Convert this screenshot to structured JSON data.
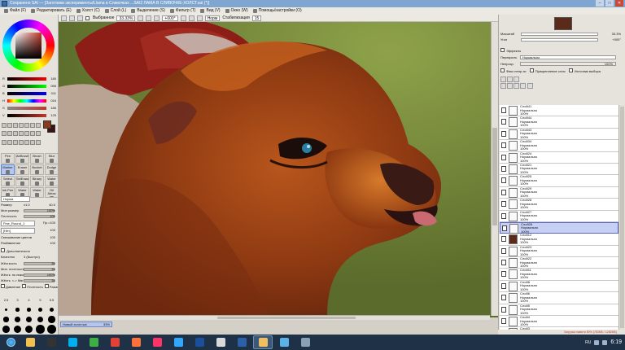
{
  "window": {
    "title": "Сохранено SAI — [Заготовки эксперименты/Llama в Сливочках ...SAI2 ЛАМА В СЛИВОЧКЕ-ХОЛСТ.sai (*)]",
    "min": "–",
    "max": "□",
    "close": "✕"
  },
  "menu": [
    "Файл (F)",
    "Редактировать (E)",
    "Холст (C)",
    "Слой (L)",
    "Выделение (S)",
    "Фильтр (T)",
    "Вид (V)",
    "Окно (W)",
    "Помощь/настройки (O)"
  ],
  "toolbar": {
    "select_label": "Выбранное",
    "zoom": "33.33%",
    "rotation": "+000°",
    "mode_label": "Норм",
    "stabilizer_label": "Стабилизация",
    "stabilizer_value": "15"
  },
  "color": {
    "sliders": [
      {
        "label": "R",
        "value": "180"
      },
      {
        "label": "G",
        "value": "055"
      },
      {
        "label": "B",
        "value": "011"
      },
      {
        "label": "H",
        "value": "016"
      },
      {
        "label": "S",
        "value": "186"
      },
      {
        "label": "V",
        "value": "125"
      }
    ],
    "fg": "#8a3a1d",
    "bg": "#3a1210"
  },
  "tools": [
    {
      "label": "Pen",
      "sel": false
    },
    {
      "label": "AirBrush",
      "sel": false
    },
    {
      "label": "Brush",
      "sel": false
    },
    {
      "label": "Blur",
      "sel": false
    },
    {
      "label": "Marker",
      "sel": true
    },
    {
      "label": "Eraser",
      "sel": false
    },
    {
      "label": "Bucket",
      "sel": false
    },
    {
      "label": "Dodge",
      "sel": false
    },
    {
      "label": "Select",
      "sel": false
    },
    {
      "label": "SelEraser",
      "sel": false
    },
    {
      "label": "Binary",
      "sel": false
    },
    {
      "label": "Water",
      "sel": false
    },
    {
      "label": "Ink Pen",
      "sel": false
    },
    {
      "label": "Water",
      "sel": false
    },
    {
      "label": "Water",
      "sel": false
    },
    {
      "label": "Oil Alexa",
      "sel": false
    }
  ],
  "brush": {
    "mode": "Норма",
    "size_label": "Размер",
    "size_mult": "x1.0",
    "size_value": "40.0",
    "min_size_label": "Мин размер",
    "min_size_value": "100%",
    "density_label": "Плотность",
    "density_value": "100",
    "shape": "Fine_Round_1",
    "shape_strength": "Пр.=100",
    "texture": "[Нет]",
    "texture_strength": "100",
    "blending_label": "Смешивание цветов",
    "blending_value": "100",
    "dilution_label": "Разбавление",
    "dilution_value": "100",
    "advanced_label": "Дополнительно",
    "quality_label": "Качество",
    "quality_value": "3 (Быстро)",
    "hardness_label": "Жёсткость",
    "hardness_value": "84",
    "minDensity_label": "Мин. плотность",
    "minDensity_value": "54",
    "maxDensity_label": "Жёстк. по пиксе",
    "maxDensity_value": "100%",
    "pressure_label": "Жёстк. <-> Мягк",
    "pressure_value": "54",
    "pressure_flags": [
      "Давление",
      "Плотность",
      "Размер"
    ],
    "presets": [
      "2.5",
      "3",
      "4",
      "5",
      "5.5",
      "6",
      "7",
      "8",
      "9",
      "10",
      "12",
      "14",
      "16",
      "20",
      "25",
      "30",
      "35",
      "40",
      "50",
      "60"
    ]
  },
  "canvas_tab": {
    "name": "Новый холст.sai",
    "percent": "33%"
  },
  "navigator": {
    "zoom_label": "Масштаб",
    "zoom_value": "33.3%",
    "angle_label": "Угол",
    "angle_value": "+000°"
  },
  "layer_panel": {
    "effects_label": "Эффекты",
    "blend_label": "Перекрыть",
    "blend_value": "Нормально",
    "opacity_label": "Непрозр.",
    "opacity_value": "100%",
    "protect_label": "Фикс непр-ти",
    "clip_label": "Прикрепление слоя",
    "source_label": "Источник выбора"
  },
  "layers": [
    {
      "name": "Слой41",
      "mode": "Нормально",
      "opacity": "100%",
      "thumb": "light",
      "selected": false
    },
    {
      "name": "Слой44",
      "mode": "Нормально",
      "opacity": "100%",
      "thumb": "light",
      "selected": false
    },
    {
      "name": "Слой43",
      "mode": "Нормально",
      "opacity": "100%",
      "thumb": "light",
      "selected": false
    },
    {
      "name": "Слой34",
      "mode": "Нормально",
      "opacity": "100%",
      "thumb": "light",
      "selected": false
    },
    {
      "name": "Слой24",
      "mode": "Нормально",
      "opacity": "100%",
      "thumb": "light",
      "selected": false
    },
    {
      "name": "Слой21",
      "mode": "Нормально",
      "opacity": "100%",
      "thumb": "light",
      "selected": false
    },
    {
      "name": "Слой25",
      "mode": "Нормально",
      "opacity": "100%",
      "thumb": "light",
      "selected": false
    },
    {
      "name": "Слой29",
      "mode": "Нормально",
      "opacity": "100%",
      "thumb": "light",
      "selected": false
    },
    {
      "name": "Слой28",
      "mode": "Нормально",
      "opacity": "100%",
      "thumb": "light",
      "selected": false
    },
    {
      "name": "Слой27",
      "mode": "Нормально",
      "opacity": "100%",
      "thumb": "light",
      "selected": false
    },
    {
      "name": "Слой26",
      "mode": "Нормально",
      "opacity": "100%",
      "thumb": "light",
      "selected": true
    },
    {
      "name": "Слой12",
      "mode": "Нормально",
      "opacity": "100%",
      "thumb": "dark",
      "selected": false
    },
    {
      "name": "Слой23",
      "mode": "Нормально",
      "opacity": "100%",
      "thumb": "light",
      "selected": false
    },
    {
      "name": "Слой22",
      "mode": "Нормально",
      "opacity": "100%",
      "thumb": "light",
      "selected": false
    },
    {
      "name": "Слой11",
      "mode": "Нормально",
      "opacity": "100%",
      "thumb": "light",
      "selected": false
    },
    {
      "name": "Слой8",
      "mode": "Нормально",
      "opacity": "100%",
      "thumb": "light",
      "selected": false
    },
    {
      "name": "Слой6",
      "mode": "Нормально",
      "opacity": "100%",
      "thumb": "light",
      "selected": false
    },
    {
      "name": "Слой5",
      "mode": "Нормально",
      "opacity": "100%",
      "thumb": "light",
      "selected": false
    },
    {
      "name": "Слой4",
      "mode": "Нормально",
      "opacity": "100%",
      "thumb": "light",
      "selected": false
    },
    {
      "name": "Слой3",
      "mode": "Нормально",
      "opacity": "100%",
      "thumb": "light",
      "selected": false
    }
  ],
  "status": "Загрузка памяти 80% (783МБ / 1282МБ)",
  "taskbar": {
    "apps": [
      {
        "name": "explorer-icon",
        "color": "#f2c14e"
      },
      {
        "name": "cmd-icon",
        "color": "#333333"
      },
      {
        "name": "skype-icon",
        "color": "#00aff0"
      },
      {
        "name": "green-app-icon",
        "color": "#3cb043"
      },
      {
        "name": "chrome-icon",
        "color": "#e34133"
      },
      {
        "name": "firefox-icon",
        "color": "#ff7139"
      },
      {
        "name": "indesign-icon",
        "color": "#ff3366"
      },
      {
        "name": "photoshop-icon",
        "color": "#31a8ff"
      },
      {
        "name": "photoshop2-icon",
        "color": "#1b4f9c"
      },
      {
        "name": "files-icon",
        "color": "#d9d9d9"
      },
      {
        "name": "sai-icon",
        "color": "#2b5fa8"
      },
      {
        "name": "sai-active-icon",
        "color": "#f0c060",
        "active": true
      },
      {
        "name": "monitor-icon",
        "color": "#5ab2e8"
      },
      {
        "name": "media-icon",
        "color": "#8aa0b5"
      }
    ],
    "lang": "RU",
    "time": "6:19"
  }
}
